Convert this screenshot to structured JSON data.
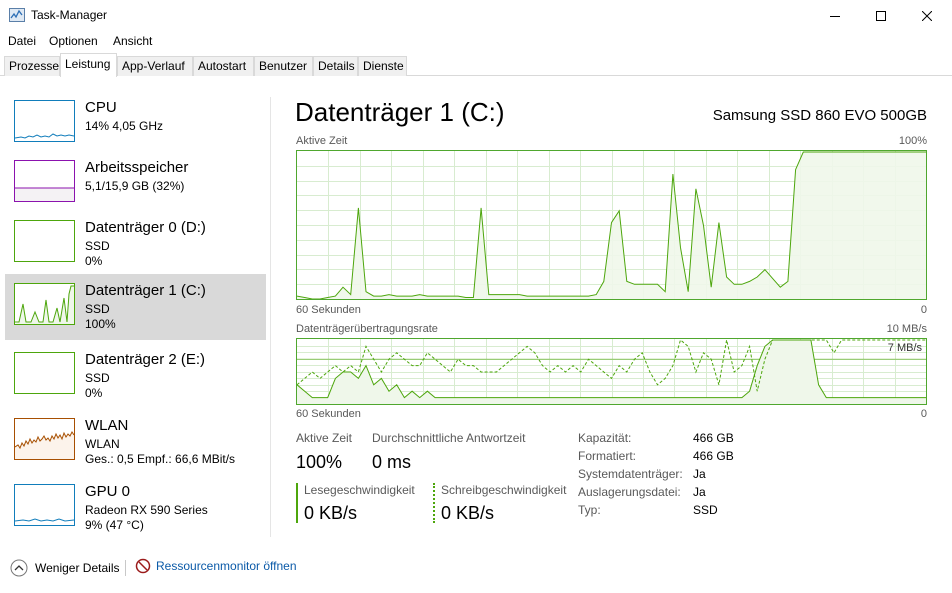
{
  "window": {
    "title": "Task-Manager"
  },
  "menu": [
    "Datei",
    "Optionen",
    "Ansicht"
  ],
  "tabs": [
    "Prozesse",
    "Leistung",
    "App-Verlauf",
    "Autostart",
    "Benutzer",
    "Details",
    "Dienste"
  ],
  "active_tab": "Leistung",
  "sidebar": {
    "items": [
      {
        "name": "CPU",
        "line1": "14% 4,05 GHz",
        "line2": "",
        "color": "#117dbb",
        "fill": "#f1f6fa"
      },
      {
        "name": "Arbeitsspeicher",
        "line1": "5,1/15,9 GB (32%)",
        "line2": "",
        "color": "#8b12ae",
        "fill": "#f4f2f4"
      },
      {
        "name": "Datenträger 0 (D:)",
        "line1": "SSD",
        "line2": "0%",
        "color": "#4da60c",
        "fill": "#eff7ea"
      },
      {
        "name": "Datenträger 1 (C:)",
        "line1": "SSD",
        "line2": "100%",
        "color": "#4da60c",
        "fill": "#eff7ea"
      },
      {
        "name": "Datenträger 2 (E:)",
        "line1": "SSD",
        "line2": "0%",
        "color": "#4da60c",
        "fill": "#eff7ea"
      },
      {
        "name": "WLAN",
        "line1": "WLAN",
        "line2": "Ges.: 0,5  Empf.: 66,6 MBit/s",
        "color": "#a74f01",
        "fill": "#fcf3eb"
      },
      {
        "name": "GPU 0",
        "line1": "Radeon RX 590 Series",
        "line2": "9% (47 °C)",
        "color": "#117dbb",
        "fill": "#f1f6fa"
      }
    ],
    "selected_index": 3
  },
  "main": {
    "title": "Datenträger 1 (C:)",
    "device": "Samsung SSD 860 EVO 500GB",
    "graph1": {
      "label": "Aktive Zeit",
      "max_label": "100%",
      "time_label": "60 Sekunden",
      "min_label": "0",
      "values": [
        2,
        1,
        0,
        0,
        1,
        2,
        8,
        3,
        62,
        5,
        2,
        2,
        3,
        2,
        2,
        2,
        3,
        2,
        2,
        2,
        2,
        2,
        1,
        1,
        62,
        3,
        3,
        3,
        3,
        3,
        2,
        2,
        2,
        2,
        2,
        2,
        2,
        2,
        2,
        3,
        12,
        52,
        60,
        12,
        10,
        10,
        10,
        10,
        5,
        85,
        35,
        5,
        75,
        50,
        8,
        52,
        15,
        10,
        10,
        12,
        15,
        20,
        14,
        8,
        12,
        88,
        100,
        100,
        100,
        100,
        100,
        100,
        100,
        100,
        100,
        100,
        100,
        100,
        100,
        100,
        100,
        100,
        100
      ]
    },
    "graph2": {
      "label": "Datenträgerübertragungsrate",
      "max_label": "10 MB/s",
      "secondary_max_label": "7 MB/s",
      "time_label": "60 Sekunden",
      "min_label": "0",
      "read_values": [
        3,
        2,
        1,
        1,
        1,
        4,
        5,
        5,
        4,
        6,
        3,
        4,
        2,
        3,
        1,
        2,
        1,
        2,
        1,
        1,
        1,
        1,
        1,
        1,
        1,
        1,
        1,
        1,
        1,
        1,
        1,
        1,
        1,
        1,
        1,
        1,
        1,
        1,
        1,
        1,
        1,
        1,
        1,
        1,
        1,
        1,
        1,
        1,
        1,
        1,
        1,
        1,
        1,
        1,
        1,
        1,
        1,
        1,
        1,
        2,
        6,
        9,
        10,
        10,
        10,
        10,
        10,
        10,
        3,
        1,
        1,
        1,
        1,
        1,
        1,
        1,
        1,
        1,
        1,
        1,
        1,
        1,
        1
      ],
      "write_values": [
        3,
        4,
        5,
        4,
        5,
        6,
        5,
        6,
        5,
        9,
        7,
        5,
        7,
        8,
        7,
        6,
        6,
        8,
        7,
        6,
        5,
        7,
        6,
        6,
        5,
        5,
        5,
        6,
        7,
        8,
        9,
        8,
        6,
        5,
        6,
        5,
        6,
        5,
        7,
        6,
        5,
        4,
        6,
        5,
        7,
        8,
        5,
        3,
        4,
        6,
        10,
        9,
        5,
        8,
        7,
        3,
        10,
        5,
        6,
        9,
        2,
        7,
        10,
        10,
        10,
        10,
        10,
        10,
        10,
        10,
        8,
        10,
        10,
        10,
        10,
        10,
        10,
        10,
        10,
        10,
        10,
        10,
        10
      ],
      "dashed_line_level": 7
    },
    "stats": {
      "active_time_label": "Aktive Zeit",
      "active_time_value": "100%",
      "avg_response_label": "Durchschnittliche Antwortzeit",
      "avg_response_value": "0 ms",
      "read_speed_label": "Lesegeschwindigkeit",
      "read_speed_value": "0 KB/s",
      "write_speed_label": "Schreibgeschwindigkeit",
      "write_speed_value": "0 KB/s"
    },
    "info": [
      {
        "label": "Kapazität:",
        "value": "466 GB"
      },
      {
        "label": "Formatiert:",
        "value": "466 GB"
      },
      {
        "label": "Systemdatenträger:",
        "value": "Ja"
      },
      {
        "label": "Auslagerungsdatei:",
        "value": "Ja"
      },
      {
        "label": "Typ:",
        "value": "SSD"
      }
    ]
  },
  "footer": {
    "fewer_details": "Weniger Details",
    "resource_monitor": "Ressourcenmonitor öffnen"
  },
  "colors": {
    "disk": "#4da60c",
    "disk_fill": "#eff7ea",
    "grid": "#d8ecd0",
    "link": "#0b5aa8"
  }
}
